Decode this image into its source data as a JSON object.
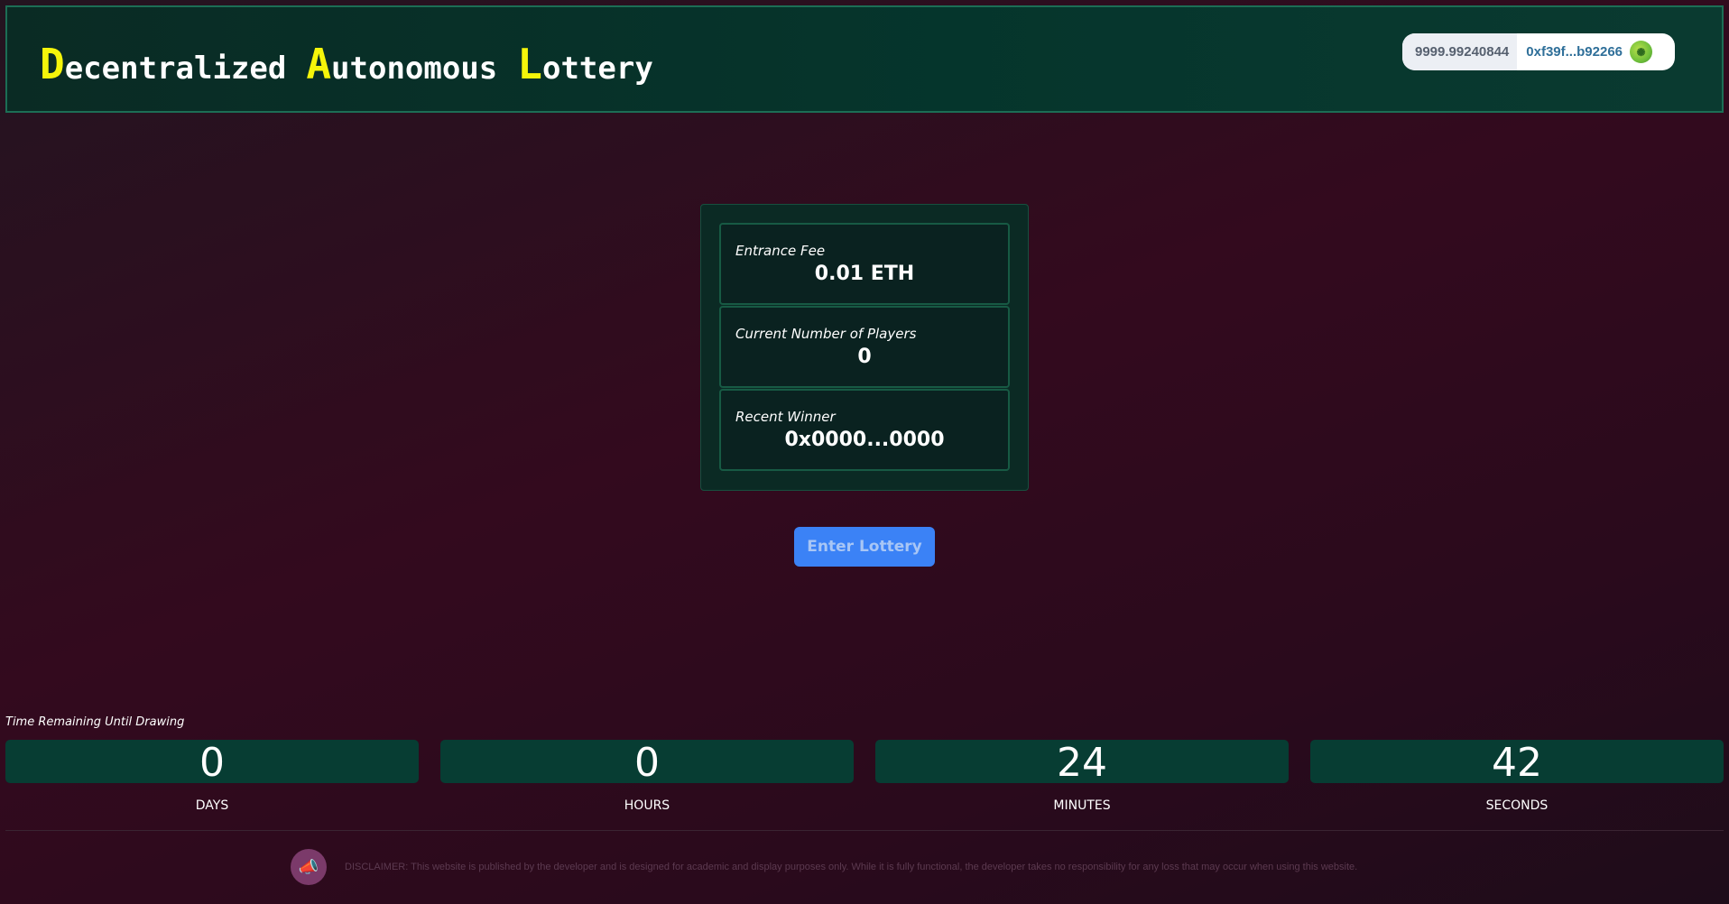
{
  "header": {
    "title_parts": [
      {
        "cap": "D",
        "rest": "ecentralized"
      },
      {
        "cap": "A",
        "rest": "utonomous"
      },
      {
        "cap": "L",
        "rest": "ottery"
      }
    ],
    "wallet_balance": "9999.99240844",
    "wallet_address": "0xf39f...b92266",
    "avatar_icon": "globe-avatar-icon"
  },
  "stats": {
    "entrance_fee_label": "Entrance Fee",
    "entrance_fee_value": "0.01 ETH",
    "players_label": "Current Number of Players",
    "players_value": "0",
    "winner_label": "Recent Winner",
    "winner_value": "0x0000...0000"
  },
  "enter_button_label": "Enter Lottery",
  "countdown": {
    "label": "Time Remaining Until Drawing",
    "days": "0",
    "hours": "0",
    "minutes": "24",
    "seconds": "42",
    "days_label": "DAYS",
    "hours_label": "HOURS",
    "minutes_label": "MINUTES",
    "seconds_label": "SECONDS"
  },
  "disclaimer": "DISCLAIMER: This website is published by the developer and is designed for academic and display purposes only. While it is fully functional, the developer takes no responsibility for any loss that may occur when using this website.",
  "colors": {
    "accent_yellow": "#f5f50a",
    "panel_green": "#0b2a24",
    "button_blue": "#3b82f6"
  }
}
